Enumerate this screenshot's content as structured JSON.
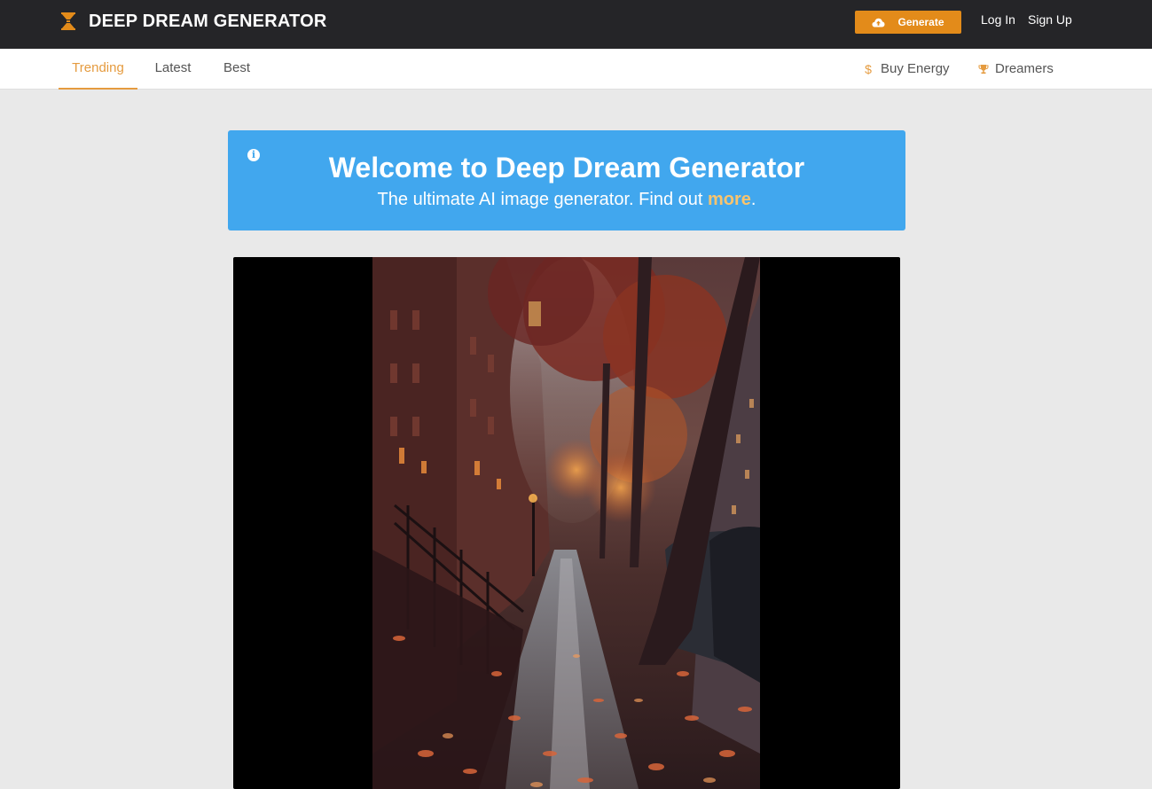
{
  "header": {
    "brand": "DEEP DREAM GENERATOR",
    "generate_label": "Generate",
    "login_label": "Log In",
    "signup_label": "Sign Up"
  },
  "nav": {
    "tabs": [
      {
        "label": "Trending",
        "active": true
      },
      {
        "label": "Latest",
        "active": false
      },
      {
        "label": "Best",
        "active": false
      }
    ],
    "right": [
      {
        "label": "Buy Energy",
        "icon": "dollar-icon"
      },
      {
        "label": "Dreamers",
        "icon": "trophy-icon"
      }
    ]
  },
  "welcome": {
    "title": "Welcome to Deep Dream Generator",
    "subtitle_before": "The ultimate AI image generator. Find out ",
    "subtitle_link": "more",
    "subtitle_after": "."
  },
  "colors": {
    "header_bg": "#252528",
    "accent": "#e38b1a",
    "active_tab": "#e59b3f",
    "banner": "#41a7ee",
    "link_more": "#f8c46e",
    "page_bg": "#e9e9e9"
  }
}
